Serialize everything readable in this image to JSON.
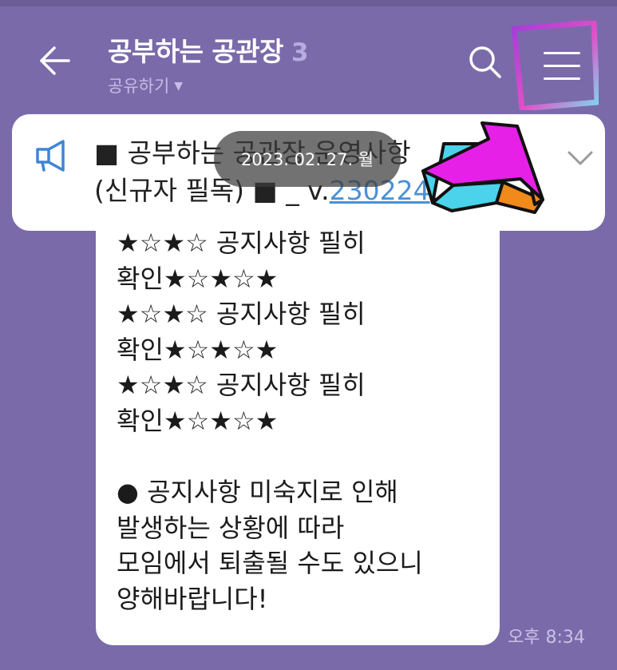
{
  "header": {
    "title": "공부하는 공관장",
    "member_count": "3",
    "share_label": "공유하기",
    "share_caret": "▼"
  },
  "notice": {
    "line1": "■ 공부하는 공관장 운영사항",
    "line2_prefix": "(신규자 필독) ■ _ v.",
    "line2_link": "230224",
    "line2_suffix": "..."
  },
  "date_pill": "2023. 02. 27. 월",
  "message": {
    "lines": [
      "★☆★☆ 공지사항 필히",
      "확인★☆★☆★",
      "★☆★☆ 공지사항 필히",
      "확인★☆★☆★",
      "★☆★☆ 공지사항 필히",
      "확인★☆★☆★",
      "",
      "● 공지사항 미숙지로 인해",
      "발생하는 상황에 따라",
      "모임에서 퇴출될 수도 있으니",
      "양해바랍니다!"
    ],
    "time": "오후 8:34"
  },
  "colors": {
    "background": "#7a6aa9",
    "bubble": "#ffffff",
    "link": "#4a90d4",
    "annotation_arrow": "#e620e6",
    "annotation_box": "#c050d0"
  }
}
